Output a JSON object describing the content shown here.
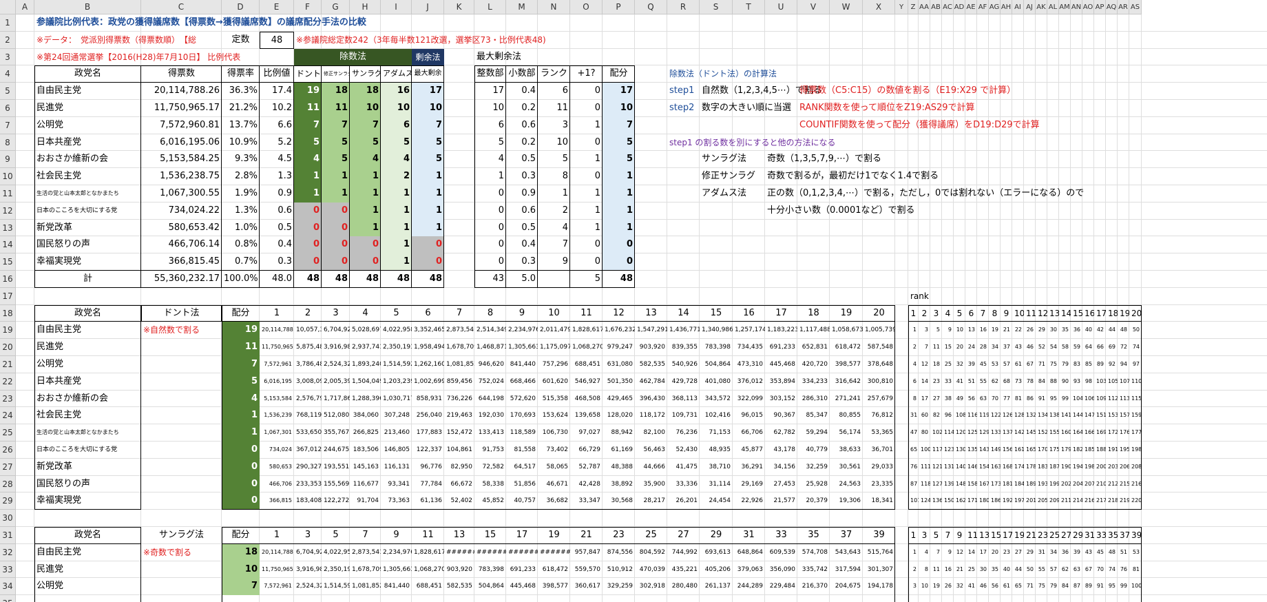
{
  "columns": [
    "A",
    "B",
    "C",
    "D",
    "E",
    "F",
    "G",
    "H",
    "I",
    "J",
    "K",
    "L",
    "M",
    "N",
    "O",
    "P",
    "Q",
    "R",
    "S",
    "T",
    "U",
    "V",
    "W",
    "X",
    "Y",
    "Z",
    "AA",
    "AB",
    "AC",
    "AD",
    "AE",
    "AF",
    "AG",
    "AH",
    "AI",
    "AJ",
    "AK",
    "AL",
    "AM",
    "AN",
    "AO",
    "AP",
    "AQ",
    "AR",
    "AS"
  ],
  "colors": {
    "dark_green": "#548235",
    "mid_green": "#a9d08e",
    "light_green": "#e2efda",
    "light_blue": "#ddebf7",
    "dark_navy": "#203864",
    "gray": "#bfbfbf",
    "header": "#375623"
  },
  "top": {
    "title": "参議院比例代表：政党の獲得議席数【得票数→獲得議席数】の議席配分手法の比較",
    "data_label": "※データ：　党派別得票数（得票数順）　【総",
    "seats_label": "定数",
    "seats_value": "48",
    "seat_note": "※参議院総定数242（3年毎半数121改選，選挙区73・比例代表48)",
    "election": "※第24回通常選挙【2016(H28)年7月10日】 比例代表",
    "group_divisor": "除数法",
    "group_remainder": "剰余法",
    "group_largest": "最大剰余法",
    "headers": [
      "政党名",
      "得票数",
      "得票率",
      "比例値",
      "ドント",
      "修正サンラグ",
      "サンラグ",
      "アダムス",
      "最大剰余",
      "整数部",
      "小数部",
      "ランク",
      "+1?",
      "配分"
    ],
    "rows": [
      [
        "自由民主党",
        "20,114,788.26",
        "36.3%",
        "17.4",
        "19",
        "18",
        "18",
        "16",
        "17",
        "17",
        "0.4",
        "6",
        "0",
        "17"
      ],
      [
        "民進党",
        "11,750,965.17",
        "21.2%",
        "10.2",
        "11",
        "11",
        "10",
        "10",
        "10",
        "10",
        "0.2",
        "11",
        "0",
        "10"
      ],
      [
        "公明党",
        "7,572,960.81",
        "13.7%",
        "6.6",
        "7",
        "7",
        "7",
        "6",
        "7",
        "6",
        "0.6",
        "3",
        "1",
        "7"
      ],
      [
        "日本共産党",
        "6,016,195.06",
        "10.9%",
        "5.2",
        "5",
        "5",
        "5",
        "5",
        "5",
        "5",
        "0.2",
        "10",
        "0",
        "5"
      ],
      [
        "おおさか維新の会",
        "5,153,584.25",
        "9.3%",
        "4.5",
        "4",
        "5",
        "4",
        "4",
        "5",
        "4",
        "0.5",
        "5",
        "1",
        "5"
      ],
      [
        "社会民主党",
        "1,536,238.75",
        "2.8%",
        "1.3",
        "1",
        "1",
        "1",
        "2",
        "1",
        "1",
        "0.3",
        "8",
        "0",
        "1"
      ],
      [
        "生活の党と山本太郎となかまたち",
        "1,067,300.55",
        "1.9%",
        "0.9",
        "1",
        "1",
        "1",
        "1",
        "1",
        "0",
        "0.9",
        "1",
        "1",
        "1"
      ],
      [
        "日本のこころを大切にする党",
        "734,024.22",
        "1.3%",
        "0.6",
        "0",
        "0",
        "1",
        "1",
        "1",
        "0",
        "0.6",
        "2",
        "1",
        "1"
      ],
      [
        "新党改革",
        "580,653.42",
        "1.0%",
        "0.5",
        "0",
        "0",
        "1",
        "1",
        "1",
        "0",
        "0.5",
        "4",
        "1",
        "1"
      ],
      [
        "国民怒りの声",
        "466,706.14",
        "0.8%",
        "0.4",
        "0",
        "0",
        "0",
        "1",
        "0",
        "0",
        "0.4",
        "7",
        "0",
        "0"
      ],
      [
        "幸福実現党",
        "366,815.45",
        "0.7%",
        "0.3",
        "0",
        "0",
        "0",
        "1",
        "0",
        "0",
        "0.3",
        "9",
        "0",
        "0"
      ]
    ],
    "total": [
      "計",
      "55,360,232.17",
      "100.0%",
      "48.0",
      "48",
      "48",
      "48",
      "48",
      "48",
      "43",
      "5.0",
      "",
      "5",
      "48"
    ]
  },
  "explain": {
    "title": "除数法（ドント法）の計算法",
    "step1": "step1",
    "step1_text": "自然数（1,2,3,4,5⋯）で割る",
    "step1_red": "得票数（C5:C15）の数値を割る（E19:X29 で計算）",
    "step2": "step2",
    "step2_text": "数字の大きい順に当選",
    "step2_red": "RANK関数を使って順位をZ19:AS29で計算",
    "step3_red": "COUNTIF関数を使って配分（獲得議席）をD19:D29で計算",
    "note": "step1 の割る数を別にすると他の方法になる",
    "m1_name": "サンラグ法",
    "m1_text": "奇数（1,3,5,7,9,⋯）で割る",
    "m2_name": "修正サンラグ",
    "m2_text": "奇数で割るが，最初だけ1でなく1.4で割る",
    "m3_name": "アダムス法",
    "m3_text": "正の数（0,1,2,3,4,⋯）で割る，ただし，0では割れない（エラーになる）ので",
    "m3_text2": "十分小さい数（0.0001など）で割る"
  },
  "dhondt": {
    "h_party": "政党名",
    "h_method": "ドント法",
    "h_alloc": "配分",
    "note": "※自然数で割る",
    "rank_label": "rank",
    "divisors": [
      "1",
      "2",
      "3",
      "4",
      "5",
      "6",
      "7",
      "8",
      "9",
      "10",
      "11",
      "12",
      "13",
      "14",
      "15",
      "16",
      "17",
      "18",
      "19",
      "20"
    ],
    "rank_headers": [
      "1",
      "2",
      "3",
      "4",
      "5",
      "6",
      "7",
      "8",
      "9",
      "10",
      "11",
      "12",
      "13",
      "14",
      "15",
      "16",
      "17",
      "18",
      "19",
      "20"
    ],
    "rows": [
      {
        "party": "自由民主党",
        "alloc": "19",
        "q": [
          "20,114,788",
          "10,057,394",
          "6,704,929",
          "5,028,697",
          "4,022,958",
          "3,352,465",
          "2,873,541",
          "2,514,349",
          "2,234,976",
          "2,011,479",
          "1,828,617",
          "1,676,232",
          "1,547,291",
          "1,436,771",
          "1,340,986",
          "1,257,174",
          "1,183,223",
          "1,117,488",
          "1,058,673",
          "1,005,739"
        ],
        "rk": [
          "1",
          "3",
          "5",
          "9",
          "10",
          "13",
          "16",
          "19",
          "21",
          "22",
          "26",
          "29",
          "30",
          "35",
          "36",
          "40",
          "42",
          "44",
          "48",
          "50"
        ]
      },
      {
        "party": "民進党",
        "alloc": "11",
        "q": [
          "11,750,965",
          "5,875,483",
          "3,916,988",
          "2,937,741",
          "2,350,193",
          "1,958,494",
          "1,678,709",
          "1,468,871",
          "1,305,663",
          "1,175,097",
          "1,068,270",
          "979,247",
          "903,920",
          "839,355",
          "783,398",
          "734,435",
          "691,233",
          "652,831",
          "618,472",
          "587,548"
        ],
        "rk": [
          "2",
          "7",
          "11",
          "15",
          "20",
          "24",
          "28",
          "34",
          "37",
          "43",
          "46",
          "52",
          "54",
          "58",
          "59",
          "64",
          "66",
          "69",
          "72",
          "74"
        ]
      },
      {
        "party": "公明党",
        "alloc": "7",
        "q": [
          "7,572,961",
          "3,786,480",
          "2,524,320",
          "1,893,240",
          "1,514,592",
          "1,262,160",
          "1,081,852",
          "946,620",
          "841,440",
          "757,296",
          "688,451",
          "631,080",
          "582,535",
          "540,926",
          "504,864",
          "473,310",
          "445,468",
          "420,720",
          "398,577",
          "378,648"
        ],
        "rk": [
          "4",
          "12",
          "18",
          "25",
          "32",
          "39",
          "45",
          "53",
          "57",
          "61",
          "67",
          "71",
          "75",
          "79",
          "83",
          "85",
          "89",
          "92",
          "94",
          "97"
        ]
      },
      {
        "party": "日本共産党",
        "alloc": "5",
        "q": [
          "6,016,195",
          "3,008,098",
          "2,005,398",
          "1,504,049",
          "1,203,239",
          "1,002,699",
          "859,456",
          "752,024",
          "668,466",
          "601,620",
          "546,927",
          "501,350",
          "462,784",
          "429,728",
          "401,080",
          "376,012",
          "353,894",
          "334,233",
          "316,642",
          "300,810"
        ],
        "rk": [
          "6",
          "14",
          "23",
          "33",
          "41",
          "51",
          "55",
          "62",
          "68",
          "73",
          "78",
          "84",
          "88",
          "90",
          "93",
          "98",
          "103",
          "105",
          "107",
          "110"
        ]
      },
      {
        "party": "おおさか維新の会",
        "alloc": "4",
        "q": [
          "5,153,584",
          "2,576,792",
          "1,717,861",
          "1,288,396",
          "1,030,717",
          "858,931",
          "736,226",
          "644,198",
          "572,620",
          "515,358",
          "468,508",
          "429,465",
          "396,430",
          "368,113",
          "343,572",
          "322,099",
          "303,152",
          "286,310",
          "271,241",
          "257,679"
        ],
        "rk": [
          "8",
          "17",
          "27",
          "38",
          "49",
          "56",
          "63",
          "70",
          "77",
          "81",
          "86",
          "91",
          "95",
          "99",
          "104",
          "106",
          "109",
          "112",
          "113",
          "115"
        ]
      },
      {
        "party": "社会民主党",
        "alloc": "1",
        "q": [
          "1,536,239",
          "768,119",
          "512,080",
          "384,060",
          "307,248",
          "256,040",
          "219,463",
          "192,030",
          "170,693",
          "153,624",
          "139,658",
          "128,020",
          "118,172",
          "109,731",
          "102,416",
          "96,015",
          "90,367",
          "85,347",
          "80,855",
          "76,812"
        ],
        "rk": [
          "31",
          "60",
          "82",
          "96",
          "108",
          "116",
          "119",
          "122",
          "126",
          "128",
          "132",
          "134",
          "138",
          "141",
          "144",
          "147",
          "151",
          "153",
          "157",
          "159"
        ]
      },
      {
        "party": "生活の党と山本太郎となかまたち",
        "alloc": "1",
        "q": [
          "1,067,301",
          "533,650",
          "355,767",
          "266,825",
          "213,460",
          "177,883",
          "152,472",
          "133,413",
          "118,589",
          "106,730",
          "97,027",
          "88,942",
          "82,100",
          "76,236",
          "71,153",
          "66,706",
          "62,782",
          "59,294",
          "56,174",
          "53,365"
        ],
        "rk": [
          "47",
          "80",
          "102",
          "114",
          "120",
          "125",
          "129",
          "133",
          "137",
          "142",
          "145",
          "152",
          "155",
          "160",
          "164",
          "166",
          "169",
          "172",
          "176",
          "177"
        ]
      },
      {
        "party": "日本のこころを大切にする党",
        "alloc": "0",
        "q": [
          "734,024",
          "367,012",
          "244,675",
          "183,506",
          "146,805",
          "122,337",
          "104,861",
          "91,753",
          "81,558",
          "73,402",
          "66,729",
          "61,169",
          "56,463",
          "52,430",
          "48,935",
          "45,877",
          "43,178",
          "40,779",
          "38,633",
          "36,701"
        ],
        "rk": [
          "65",
          "100",
          "117",
          "123",
          "130",
          "135",
          "143",
          "149",
          "156",
          "161",
          "165",
          "170",
          "175",
          "179",
          "182",
          "185",
          "188",
          "191",
          "195",
          "198"
        ]
      },
      {
        "party": "新党改革",
        "alloc": "0",
        "q": [
          "580,653",
          "290,327",
          "193,551",
          "145,163",
          "116,131",
          "96,776",
          "82,950",
          "72,582",
          "64,517",
          "58,065",
          "52,787",
          "48,388",
          "44,666",
          "41,475",
          "38,710",
          "36,291",
          "34,156",
          "32,259",
          "30,561",
          "29,033"
        ],
        "rk": [
          "76",
          "111",
          "121",
          "131",
          "140",
          "146",
          "154",
          "163",
          "168",
          "174",
          "178",
          "183",
          "187",
          "190",
          "194",
          "198",
          "200",
          "203",
          "206",
          "208"
        ]
      },
      {
        "party": "国民怒りの声",
        "alloc": "0",
        "q": [
          "466,706",
          "233,353",
          "155,569",
          "116,677",
          "93,341",
          "77,784",
          "66,672",
          "58,338",
          "51,856",
          "46,671",
          "42,428",
          "38,892",
          "35,900",
          "33,336",
          "31,114",
          "29,169",
          "27,453",
          "25,928",
          "24,563",
          "23,335"
        ],
        "rk": [
          "87",
          "118",
          "127",
          "139",
          "148",
          "158",
          "167",
          "173",
          "181",
          "184",
          "189",
          "193",
          "199",
          "202",
          "204",
          "207",
          "210",
          "212",
          "215",
          "216"
        ]
      },
      {
        "party": "幸福実現党",
        "alloc": "0",
        "q": [
          "366,815",
          "183,408",
          "122,272",
          "91,704",
          "73,363",
          "61,136",
          "52,402",
          "45,852",
          "40,757",
          "36,682",
          "33,347",
          "30,568",
          "28,217",
          "26,201",
          "24,454",
          "22,926",
          "21,577",
          "20,379",
          "19,306",
          "18,341"
        ],
        "rk": [
          "101",
          "124",
          "136",
          "150",
          "162",
          "171",
          "180",
          "186",
          "192",
          "197",
          "201",
          "205",
          "209",
          "211",
          "214",
          "216",
          "217",
          "218",
          "219",
          "220"
        ]
      }
    ]
  },
  "sainte": {
    "h_party": "政党名",
    "h_method": "サンラグ法",
    "h_alloc": "配分",
    "note": "※奇数で割る",
    "divisors": [
      "1",
      "3",
      "5",
      "7",
      "9",
      "11",
      "13",
      "15",
      "17",
      "19",
      "21",
      "23",
      "25",
      "27",
      "29",
      "31",
      "33",
      "35",
      "37",
      "39"
    ],
    "rank_headers": [
      "1",
      "3",
      "5",
      "7",
      "9",
      "11",
      "13",
      "15",
      "17",
      "19",
      "21",
      "23",
      "25",
      "27",
      "29",
      "31",
      "33",
      "35",
      "37",
      "39"
    ],
    "rows": [
      {
        "party": "自由民主党",
        "alloc": "18",
        "q": [
          "20,114,788",
          "6,704,929",
          "4,022,958",
          "2,873,541",
          "2,234,976",
          "1,828,617",
          "#######",
          "#######",
          "#######",
          "#######",
          "957,847",
          "874,556",
          "804,592",
          "744,992",
          "693,613",
          "648,864",
          "609,539",
          "574,708",
          "543,643",
          "515,764"
        ],
        "rk": [
          "1",
          "4",
          "7",
          "9",
          "12",
          "14",
          "17",
          "20",
          "23",
          "27",
          "29",
          "31",
          "34",
          "36",
          "39",
          "43",
          "45",
          "48",
          "51",
          "53"
        ]
      },
      {
        "party": "民進党",
        "alloc": "10",
        "q": [
          "11,750,965",
          "3,916,988",
          "2,350,193",
          "1,678,709",
          "1,305,663",
          "1,068,270",
          "903,920",
          "783,398",
          "691,233",
          "618,472",
          "559,570",
          "510,912",
          "470,039",
          "435,221",
          "405,206",
          "379,063",
          "356,090",
          "335,742",
          "317,594",
          "301,307"
        ],
        "rk": [
          "2",
          "8",
          "11",
          "16",
          "21",
          "25",
          "30",
          "35",
          "40",
          "44",
          "50",
          "55",
          "57",
          "62",
          "63",
          "67",
          "70",
          "74",
          "76",
          "81"
        ]
      },
      {
        "party": "公明党",
        "alloc": "7",
        "q": [
          "7,572,961",
          "2,524,320",
          "1,514,592",
          "1,081,852",
          "841,440",
          "688,451",
          "582,535",
          "504,864",
          "445,468",
          "398,577",
          "360,617",
          "329,259",
          "302,918",
          "280,480",
          "261,137",
          "244,289",
          "229,484",
          "216,370",
          "204,675",
          "194,178"
        ],
        "rk": [
          "3",
          "10",
          "19",
          "26",
          "32",
          "41",
          "46",
          "56",
          "61",
          "65",
          "71",
          "75",
          "79",
          "84",
          "87",
          "89",
          "91",
          "95",
          "99",
          "100"
        ]
      }
    ]
  }
}
